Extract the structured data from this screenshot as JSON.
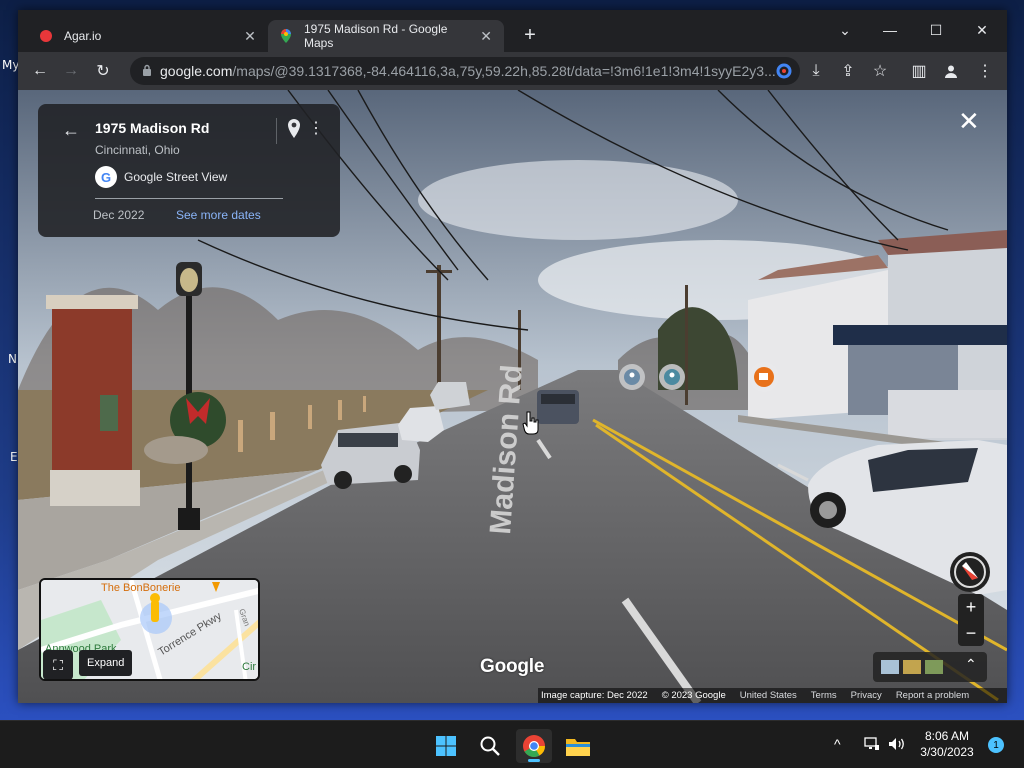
{
  "desktop": {
    "labels": [
      "My",
      "N",
      "E"
    ]
  },
  "browser": {
    "tabs": [
      {
        "title": "Agar.io",
        "icon": "agar-dot-icon",
        "color": "#e8373a"
      },
      {
        "title": "1975 Madison Rd - Google Maps",
        "icon": "google-maps-icon",
        "active": true
      }
    ],
    "new_tab": "+",
    "window_controls": {
      "dropdown": "⌄",
      "minimize": "—",
      "maximize": "☐",
      "close": "✕"
    },
    "url": {
      "host": "google.com",
      "path": "/maps/@39.1317368,-84.464116,3a,75y,59.22h,85.28t/data=!3m6!1e1!3m4!1syyE2y3..."
    }
  },
  "street_view": {
    "card": {
      "title": "1975 Madison Rd",
      "subtitle": "Cincinnati, Ohio",
      "source": "Google Street View",
      "date": "Dec 2022",
      "more_dates": "See more dates"
    },
    "road_label": "Madison Rd",
    "watermark": "Google",
    "minimap": {
      "places": [
        "The BonBonerie",
        "Annwood Park",
        "Torrence Pkwy",
        "Gran",
        "Cir"
      ],
      "expand_label": "Expand"
    },
    "attribution": {
      "capture": "Image capture: Dec 2022",
      "copyright": "© 2023 Google",
      "links": [
        "United States",
        "Terms",
        "Privacy",
        "Report a problem"
      ]
    },
    "zoom_in": "+",
    "zoom_out": "−"
  },
  "taskbar": {
    "apps": [
      "windows-start-icon",
      "search-icon",
      "chrome-icon",
      "file-explorer-icon"
    ],
    "clock": {
      "time": "8:06 AM",
      "date": "3/30/2023"
    },
    "notification_count": "1",
    "tray_chevron": "^"
  },
  "colors": {
    "link": "#8ab4f8",
    "accent": "#4cc2ff"
  }
}
